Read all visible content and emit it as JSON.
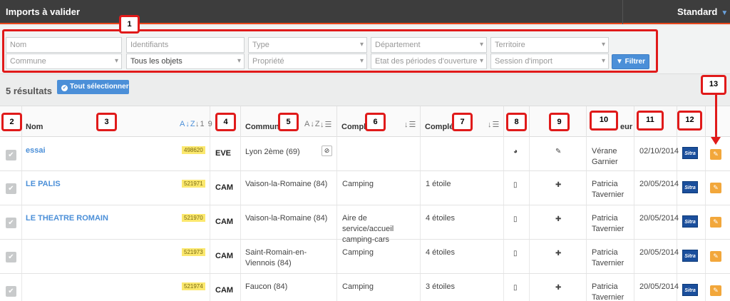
{
  "topbar": {
    "title": "Imports à valider",
    "view_label": "Standard"
  },
  "filters": {
    "nom": "Nom",
    "identifiants": "Identifiants",
    "type": "Type",
    "departement": "Département",
    "territoire": "Territoire",
    "commune": "Commune",
    "objets": "Tous les objets",
    "propriete": "Propriété",
    "etat_periodes": "Etat des périodes d'ouverture",
    "session": "Session d'import",
    "filter_button": "Filtrer"
  },
  "results": {
    "count_label": "5 résultats",
    "select_all_label": "Tout sélectionner"
  },
  "columns": {
    "nom": "Nom",
    "commune": "Commune",
    "complement1": "Comple",
    "complement2": "Complé",
    "auteur_frag": "eur"
  },
  "sort_icons": {
    "alpha": "A↓Z",
    "num": "↓1 9",
    "lines": "↓☰"
  },
  "badges": [
    "1",
    "2",
    "3",
    "4",
    "5",
    "6",
    "7",
    "8",
    "9",
    "10",
    "11",
    "12",
    "13"
  ],
  "rows": [
    {
      "name": "essai",
      "code": "498620",
      "type": "EVE",
      "commune": "Lyon 2ème (69)",
      "complement1": "",
      "complement2": "",
      "auteur": "Vérane Garnier",
      "date": "02/10/2014",
      "col8_icon": "globe-icon",
      "col9_icon": "pencil-icon",
      "col8": "◕",
      "col9": "✎"
    },
    {
      "name": "LE PALIS",
      "code": "521971",
      "type": "CAM",
      "commune": "Vaison-la-Romaine (84)",
      "complement1": "Camping",
      "complement2": "1 étoile",
      "auteur": "Patricia Tavernier",
      "date": "20/05/2014",
      "col8_icon": "document-icon",
      "col9_icon": "plus-icon",
      "col8": "▯",
      "col9": "✚"
    },
    {
      "name": "LE THEATRE ROMAIN",
      "code": "521970",
      "type": "CAM",
      "commune": "Vaison-la-Romaine (84)",
      "complement1": "Aire de service/accueil camping-cars",
      "complement2": "4 étoiles",
      "auteur": "Patricia Tavernier",
      "date": "20/05/2014",
      "col8_icon": "document-icon",
      "col9_icon": "plus-icon",
      "col8": "▯",
      "col9": "✚"
    },
    {
      "name": "",
      "code": "521973",
      "type": "CAM",
      "commune": "Saint-Romain-en-Viennois (84)",
      "complement1": "Camping",
      "complement2": "4 étoiles",
      "auteur": "Patricia Tavernier",
      "date": "20/05/2014",
      "col8_icon": "document-icon",
      "col9_icon": "plus-icon",
      "col8": "▯",
      "col9": "✚"
    },
    {
      "name": "",
      "code": "521974",
      "type": "CAM",
      "commune": "Faucon (84)",
      "complement1": "Camping",
      "complement2": "3 étoiles",
      "auteur": "Patricia Tavernier",
      "date": "20/05/2014",
      "col8_icon": "document-icon",
      "col9_icon": "plus-icon",
      "col8": "▯",
      "col9": "✚"
    }
  ],
  "sitra_label": "Sitra",
  "colors": {
    "accent": "#4b8fd8",
    "annotation": "#e01a1a",
    "topbar": "#3d3d3d",
    "edit": "#f2a73b"
  }
}
